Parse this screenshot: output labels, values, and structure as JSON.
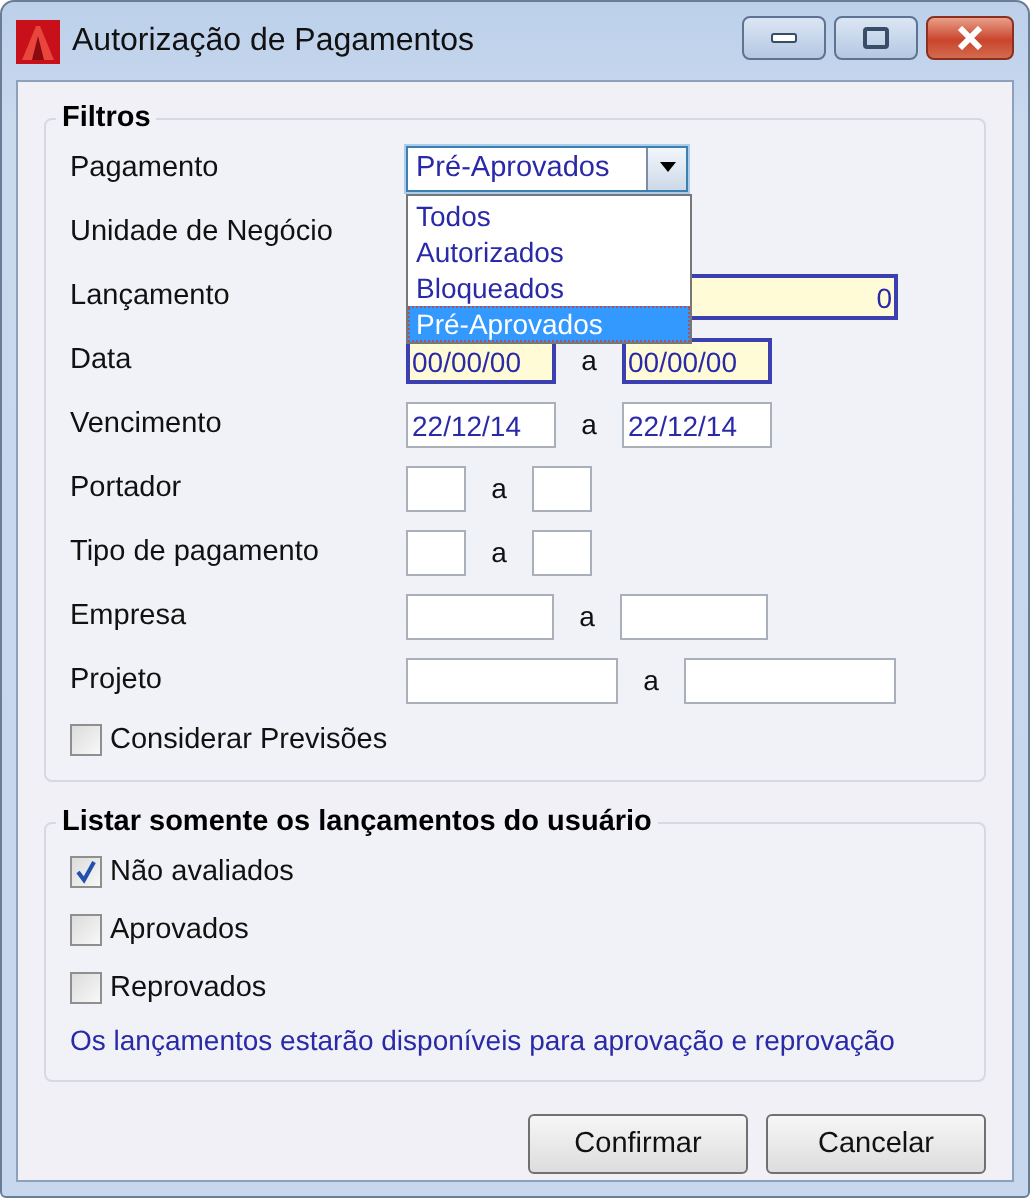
{
  "window": {
    "title": "Autorização de Pagamentos"
  },
  "filters": {
    "title": "Filtros",
    "payment": {
      "label": "Pagamento",
      "value": "Pré-Aprovados",
      "expanded": true,
      "options": [
        {
          "label": "Todos",
          "selected": false
        },
        {
          "label": "Autorizados",
          "selected": false
        },
        {
          "label": "Bloqueados",
          "selected": false
        },
        {
          "label": "Pré-Aprovados",
          "selected": true
        }
      ]
    },
    "rows": [
      {
        "label": "Unidade de Negócio",
        "kind": "label"
      },
      {
        "label": "Lançamento",
        "kind": "single",
        "field": {
          "value": "0",
          "required": true
        }
      },
      {
        "label": "Data",
        "kind": "range",
        "separator": "a",
        "from": {
          "value": "00/00/00",
          "required": true
        },
        "to": {
          "value": "00/00/00",
          "required": true
        }
      },
      {
        "label": "Vencimento",
        "kind": "range",
        "separator": "a",
        "from": {
          "value": "22/12/14",
          "required": false
        },
        "to": {
          "value": "22/12/14",
          "required": false
        }
      },
      {
        "label": "Portador",
        "kind": "range",
        "separator": "a",
        "from": {
          "required": false
        },
        "to": {
          "required": false
        }
      },
      {
        "label": "Tipo de pagamento",
        "kind": "range",
        "separator": "a",
        "from": {
          "required": false
        },
        "to": {
          "required": false
        }
      },
      {
        "label": "Empresa",
        "kind": "range",
        "separator": "a",
        "from": {
          "required": false
        },
        "to": {
          "required": false
        }
      },
      {
        "label": "Projeto",
        "kind": "range",
        "separator": "a",
        "from": {
          "required": false
        },
        "to": {
          "required": false
        }
      }
    ],
    "checkbox": {
      "label": "Considerar Previsões",
      "checked": false
    }
  },
  "user_filter": {
    "title": "Listar somente os lançamentos do usuário",
    "options": [
      {
        "label": "Não avaliados",
        "checked": true
      },
      {
        "label": "Aprovados",
        "checked": false
      },
      {
        "label": "Reprovados",
        "checked": false
      }
    ],
    "note": "Os lançamentos estarão disponíveis para aprovação e reprovação"
  },
  "buttons": [
    {
      "label": "Confirmar"
    },
    {
      "label": "Cancelar"
    }
  ]
}
